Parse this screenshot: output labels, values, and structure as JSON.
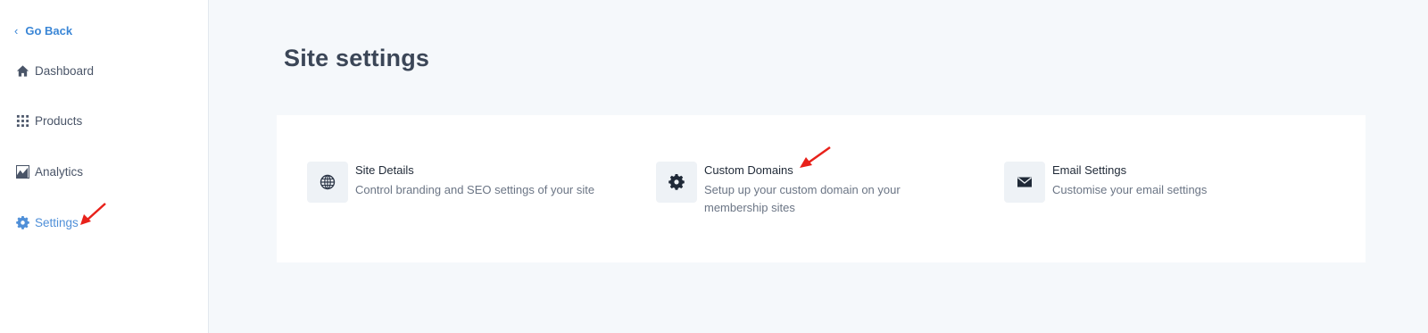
{
  "sidebar": {
    "back_label": "Go Back",
    "items": [
      {
        "label": "Dashboard",
        "icon": "home-icon"
      },
      {
        "label": "Products",
        "icon": "grid-icon"
      },
      {
        "label": "Analytics",
        "icon": "chart-icon"
      },
      {
        "label": "Settings",
        "icon": "gear-icon",
        "active": true
      }
    ]
  },
  "main": {
    "title": "Site settings",
    "settings": [
      {
        "title": "Site Details",
        "description": "Control branding and SEO settings of your site",
        "icon": "globe-icon"
      },
      {
        "title": "Custom Domains",
        "description": "Setup up your custom domain on your membership sites",
        "icon": "gear-icon"
      },
      {
        "title": "Email Settings",
        "description": "Customise your email settings",
        "icon": "envelope-icon"
      }
    ]
  },
  "colors": {
    "accent": "#3a86d6",
    "active_nav": "#4f8fd8",
    "annotation_arrow": "#e8211a",
    "page_bg": "#f5f8fb"
  }
}
